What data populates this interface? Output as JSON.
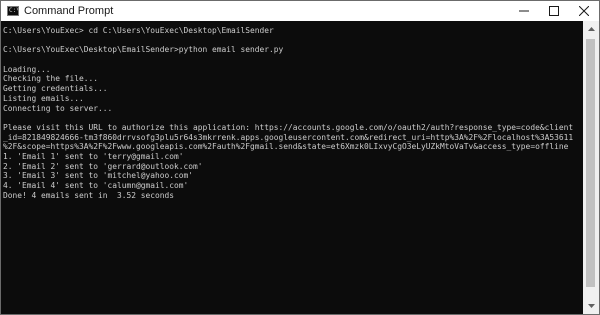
{
  "window": {
    "title": "Command Prompt",
    "icon": "cmd-icon",
    "icon_glyph": "C:\\"
  },
  "controls": {
    "minimize": "minimize-icon",
    "maximize": "maximize-icon",
    "close": "close-icon"
  },
  "console": {
    "lines": [
      "C:\\Users\\YouExec> cd C:\\Users\\YouExec\\Desktop\\EmailSender",
      "",
      "C:\\Users\\YouExec\\Desktop\\EmailSender>python email sender.py",
      "",
      "Loading...",
      "Checking the file...",
      "Getting credentials...",
      "Listing emails...",
      "Connecting to server...",
      "",
      "Please visit this URL to authorize this application: https://accounts.google.com/o/oauth2/auth?response_type=code&client",
      "_id=821849824666-tm3f860drrvsofg3plu5r64s3mkrrenk.apps.googleusercontent.com&redirect_uri=http%3A%2F%2Flocalhost%3A53611",
      "%2F&scope=https%3A%2F%2Fwww.googleapis.com%2Fauth%2Fgmail.send&state=et6Xmzk0LIxvyCgO3eLyUZkMtoVaTv&access_type=offline",
      "1. 'Email 1' sent to 'terry@gmail.com'",
      "2. 'Email 2' sent to 'gerrard@outlook.com'",
      "3. 'Email 3' sent to 'mitchel@yahoo.com'",
      "4. 'Email 4' sent to 'calumn@gmail.com'",
      "Done! 4 emails sent in  3.52 seconds"
    ]
  },
  "colors": {
    "console_bg": "#0c0c0c",
    "console_text": "#cccccc",
    "titlebar_bg": "#ffffff"
  }
}
